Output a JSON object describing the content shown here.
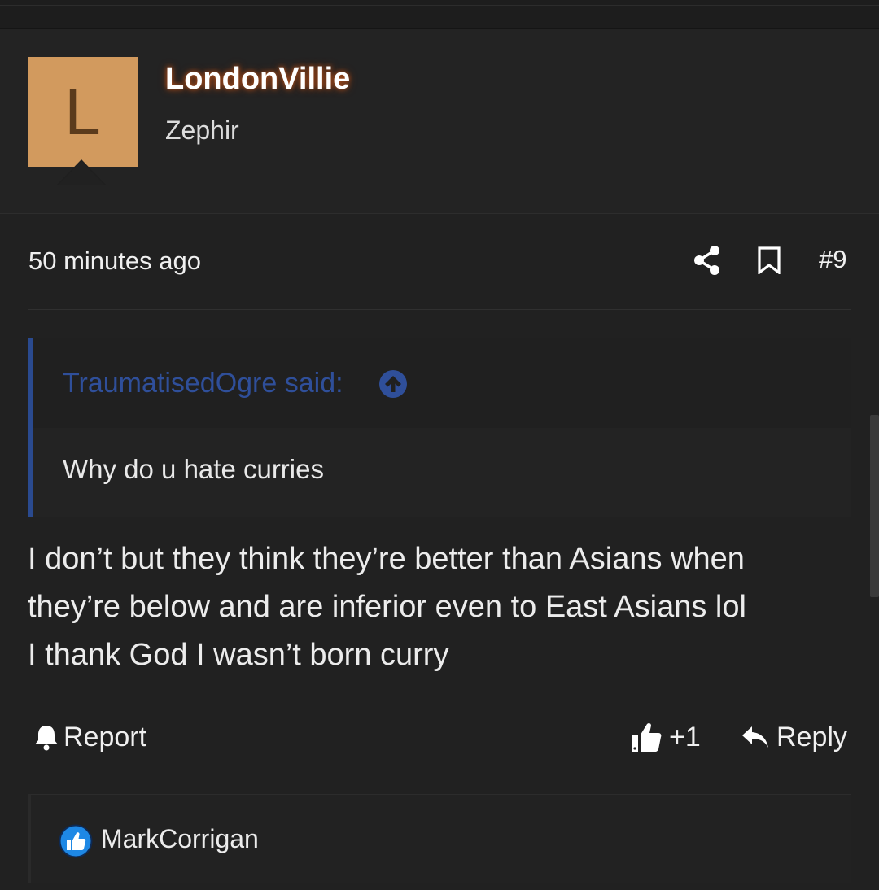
{
  "post": {
    "author": {
      "avatar_letter": "L",
      "avatar_color": "#d29a5e",
      "username": "LondonVillie",
      "user_title": "Zephir"
    },
    "timestamp": "50 minutes ago",
    "post_number": "#9",
    "icons": {
      "share": "share-icon",
      "bookmark": "bookmark-icon"
    },
    "quote": {
      "author_label": "TraumatisedOgre said:",
      "text": "Why do u hate curries",
      "accent_color": "#2a4a8f"
    },
    "body_lines": [
      "I don’t but they think they’re better than Asians when",
      "they’re below and are inferior even to East Asians lol",
      "I thank God I wasn’t born curry"
    ],
    "actions": {
      "report_label": "Report",
      "like_count": "+1",
      "reply_label": "Reply"
    },
    "reactions": {
      "reactor": "MarkCorrigan",
      "reaction_icon": "like-reaction-icon",
      "reaction_color": "#1e88e5"
    }
  }
}
